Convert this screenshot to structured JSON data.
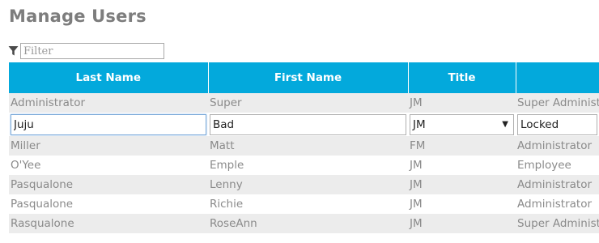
{
  "page": {
    "title": "Manage Users"
  },
  "filter": {
    "placeholder": "Filter",
    "value": ""
  },
  "table": {
    "columns": [
      "Last Name",
      "First Name",
      "Title",
      ""
    ],
    "rows_before": [
      {
        "last": "Administrator",
        "first": "Super",
        "title": "JM",
        "role": "Super Administrator"
      }
    ],
    "edit_row": {
      "last": "Juju",
      "first": "Bad",
      "title": "JM",
      "role": "Locked"
    },
    "rows_after": [
      {
        "last": "Miller",
        "first": "Matt",
        "title": "FM",
        "role": "Administrator"
      },
      {
        "last": "O'Yee",
        "first": "Emple",
        "title": "JM",
        "role": "Employee"
      },
      {
        "last": "Pasqualone",
        "first": "Lenny",
        "title": "JM",
        "role": "Administrator"
      },
      {
        "last": "Pasqualone",
        "first": "Richie",
        "title": "JM",
        "role": "Administrator"
      },
      {
        "last": "Rasqualone",
        "first": "RoseAnn",
        "title": "JM",
        "role": "Super Administrator"
      }
    ]
  },
  "colors": {
    "header_bg": "#03a9dc",
    "zebra_bg": "#ececec",
    "title_text": "#7d7d7d"
  },
  "icons": {
    "filter": "funnel-icon"
  }
}
